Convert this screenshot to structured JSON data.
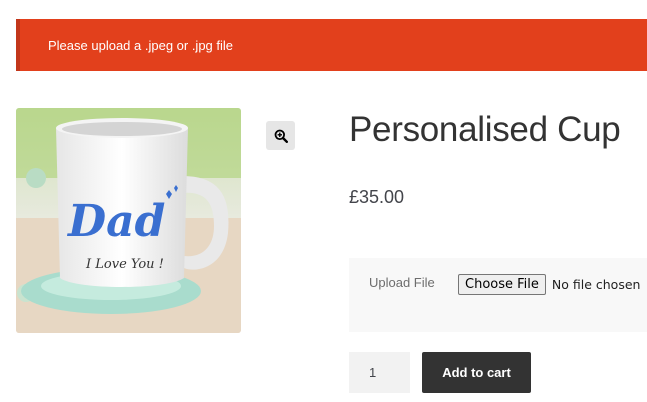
{
  "notice": {
    "message": "Please upload a .jpeg or .jpg file"
  },
  "product": {
    "image": {
      "mug_text_main": "Dad",
      "mug_text_sub": "I Love You !"
    },
    "zoom_icon": "magnifier-plus-icon",
    "title": "Personalised Cup",
    "price": "£35.00"
  },
  "upload": {
    "label": "Upload File",
    "button_label": "Choose File",
    "status": "No file chosen"
  },
  "cart": {
    "quantity": "1",
    "add_to_cart_label": "Add to cart"
  },
  "colors": {
    "notice_bg": "#e2401c",
    "button_bg": "#333333",
    "mug_text": "#3a6fd0"
  }
}
